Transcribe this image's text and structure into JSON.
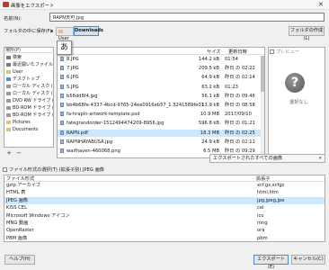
{
  "window": {
    "title": "画像をエクスポート",
    "close": "✕"
  },
  "name_row": {
    "label": "名前(N):",
    "value": "RAPN天可.jpg"
  },
  "folder_row": {
    "label": "フォルダの中に保存(F):",
    "back": "◂",
    "crumbs": [
      "User",
      "Downloads"
    ],
    "create_folder": "フォルダの作成(L)"
  },
  "ime_char": "あ",
  "places": {
    "header": "場所(P)",
    "items": [
      {
        "label": "検索",
        "color": "#7a7a7a"
      },
      {
        "label": "最近開いたファイル",
        "color": "#7a7a7a"
      },
      {
        "label": "User",
        "color": "#e8c26a"
      },
      {
        "label": "デスクトップ",
        "color": "#4a90d9"
      },
      {
        "label": "ローカル ディスク (C:)",
        "color": "#9a9a9a"
      },
      {
        "label": "ローカル ディスク (D:)",
        "color": "#9a9a9a"
      },
      {
        "label": "DVD RW ドライブ (E:)",
        "color": "#9a9a9a"
      },
      {
        "label": "BD-ROM ドライブ (F:)",
        "color": "#9a9a9a"
      },
      {
        "label": "BD-ROM ドライブ (G:)",
        "color": "#9a9a9a"
      },
      {
        "label": "Pictures",
        "color": "#e8c26a"
      },
      {
        "label": "Documents",
        "color": "#e8c26a"
      }
    ],
    "add": "+",
    "remove": "−"
  },
  "file_list": {
    "headers": {
      "name": "名前",
      "size": "サイズ",
      "modified": "更新日時"
    },
    "rows": [
      {
        "name": "8.JPG",
        "size": "144.2 kB",
        "modified": "01:54",
        "selected": false
      },
      {
        "name": "7.JPG",
        "size": "209.5 kB",
        "modified": "昨日 の 02:22",
        "selected": false
      },
      {
        "name": "6.JPG",
        "size": "64.9 kB",
        "modified": "昨日 の 02:14",
        "selected": false
      },
      {
        "name": "5.JPG",
        "size": "63.2 kB",
        "modified": "01:23",
        "selected": false
      },
      {
        "name": "b56dd8f4.jpg",
        "size": "56.1 kB",
        "modified": "昨日 の 09:46",
        "selected": false
      },
      {
        "name": "bb4b68fe-4337-4bcd-9765-24ee0916eb57_1.3241589fe01561803a53bf...",
        "size": "13.9 kB",
        "modified": "昨日 の 08:58",
        "selected": false
      },
      {
        "name": "fa-hrapin-artwork-template.psd",
        "size": "10.9 MB",
        "modified": "2017/09/10",
        "selected": false
      },
      {
        "name": "fategrandorder-151249447420­9-8956.jpg",
        "size": "596.8 kB",
        "modified": "昨日 の 01:21",
        "selected": false
      },
      {
        "name": "RAPN.pdf",
        "size": "18.3 MB",
        "modified": "昨日 の 02:25",
        "selected": true
      },
      {
        "name": "RAPNHAYABUSA.jpg",
        "size": "24.9 kB",
        "modified": "昨日 の 02:11",
        "selected": false
      },
      {
        "name": "waifhaven-460068.png",
        "size": "6.5 MB",
        "modified": "昨日 の 09:29",
        "selected": false
      }
    ]
  },
  "preview": {
    "label": "プレビュー",
    "icon": "?",
    "none_text": "選択なし"
  },
  "filter_combo": {
    "value": "エクスポートされたすべての画像",
    "arrow": "▾"
  },
  "file_type_toggle": "ファイル形式の選択(T) (拡張子別) JPEG 画像",
  "type_table": {
    "headers": {
      "type": "ファイル形式",
      "ext": "拡張子"
    },
    "rows": [
      {
        "type": "gzip アーカイブ",
        "ext": "xcf.gz,xcfgz",
        "selected": false
      },
      {
        "type": "HTML 表",
        "ext": "html,htm",
        "selected": false
      },
      {
        "type": "JPEG 画像",
        "ext": "jpg,jpeg,jpe",
        "selected": true
      },
      {
        "type": "KISS CEL",
        "ext": "cel",
        "selected": false
      },
      {
        "type": "Microsoft Windows アイコン",
        "ext": "ico",
        "selected": false
      },
      {
        "type": "MNG 動画",
        "ext": "mng",
        "selected": false
      },
      {
        "type": "OpenRaster",
        "ext": "ora",
        "selected": false
      },
      {
        "type": "PBM 画像",
        "ext": "pbm",
        "selected": false
      }
    ]
  },
  "buttons": {
    "help": "ヘルプ(H)",
    "export": "エクスポート(E)",
    "cancel": "キャンセル(C)"
  }
}
